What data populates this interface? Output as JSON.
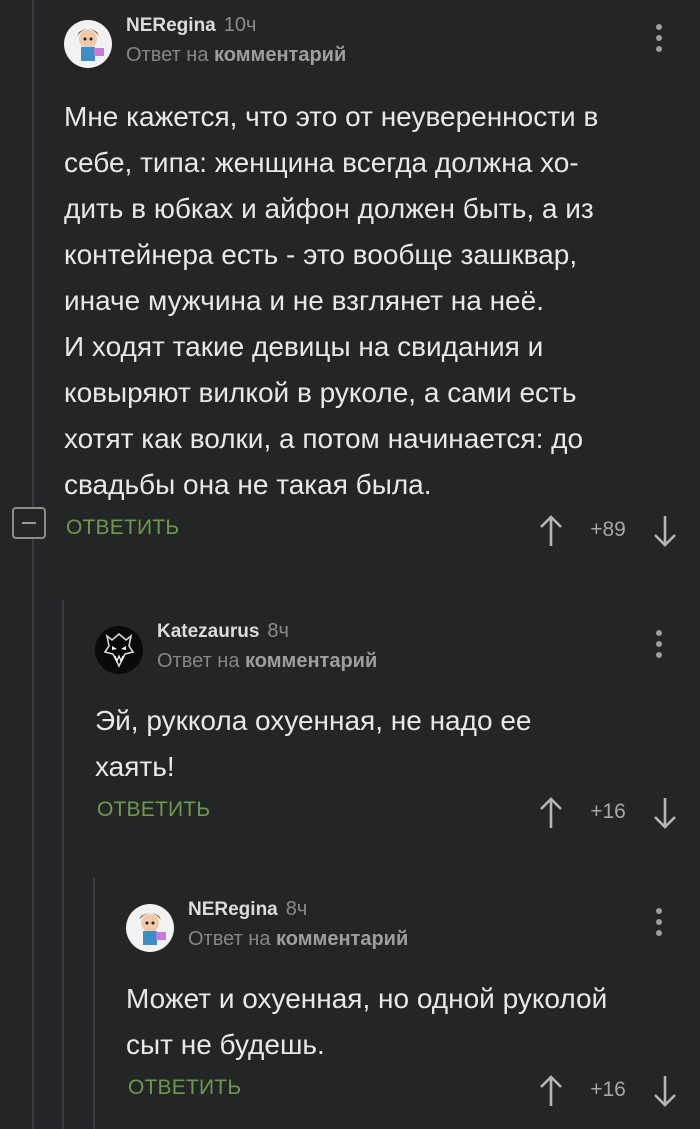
{
  "comments": [
    {
      "author": "NERegina",
      "time": "10ч",
      "reply_prefix": "Ответ на",
      "reply_link": "комментарий",
      "text": "Мне кажется, что это от неуверенности в\nсебе, типа: женщина всегда должна хо-\nдить в юбках и айфон должен быть, а из\nконтейнера есть - это вообще зашквар,\nиначе мужчина и не взглянет на неё.\nИ ходят такие девицы на свидания и\nковыряют вилкой в руколе, а сами есть\nхотят как волки, а потом начинается: до\nсвадьбы она не такая была.",
      "reply_label": "ОТВЕТИТЬ",
      "score": "+89"
    },
    {
      "author": "Katezaurus",
      "time": "8ч",
      "reply_prefix": "Ответ на",
      "reply_link": "комментарий",
      "text": "Эй, руккола охуенная, не надо ее\nхаять!",
      "reply_label": "ОТВЕТИТЬ",
      "score": "+16"
    },
    {
      "author": "NERegina",
      "time": "8ч",
      "reply_prefix": "Ответ на",
      "reply_link": "комментарий",
      "text": "Может и охуенная, но одной руколой\nсыт не будешь.",
      "reply_label": "ОТВЕТИТЬ",
      "score": "+16"
    }
  ],
  "colors": {
    "background": "#242527",
    "reply_green": "#6c9a4a",
    "thread_line": "#3a3b3e"
  }
}
